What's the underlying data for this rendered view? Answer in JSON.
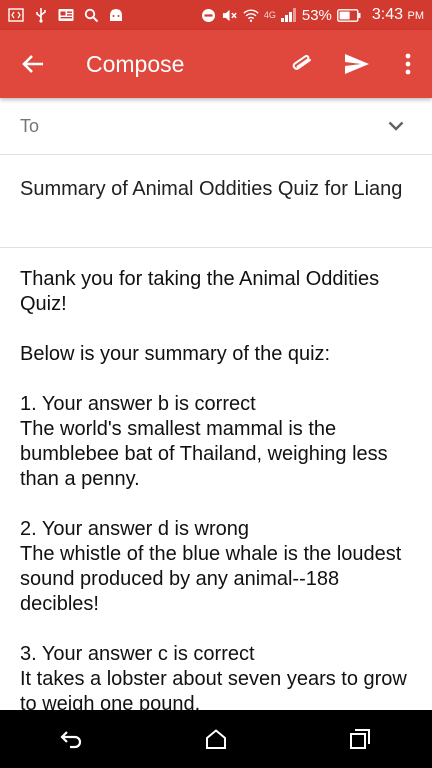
{
  "status_bar": {
    "battery": "53%",
    "time": "3:43",
    "ampm": "PM",
    "network": "4G"
  },
  "app_bar": {
    "title": "Compose"
  },
  "to_field": {
    "label": "To"
  },
  "subject": "Summary of Animal Oddities Quiz for Liang",
  "body": {
    "intro": "Thank you for taking the Animal Oddities Quiz!",
    "summary_line": "Below is your summary of the quiz:",
    "answers": [
      {
        "heading": "1. Your answer b is correct",
        "text": "The world's smallest mammal is the bumblebee bat of Thailand, weighing less than a penny."
      },
      {
        "heading": "2. Your answer d is wrong",
        "text": "The whistle of the blue whale is the loudest sound produced by any animal--188 decibles!"
      },
      {
        "heading": "3. Your answer c is correct",
        "text": "It takes a lobster about seven years to grow to weigh one pound."
      }
    ]
  },
  "colors": {
    "status_bar": "#d2392f",
    "app_bar": "#e0483e",
    "nav_bar": "#000000"
  }
}
